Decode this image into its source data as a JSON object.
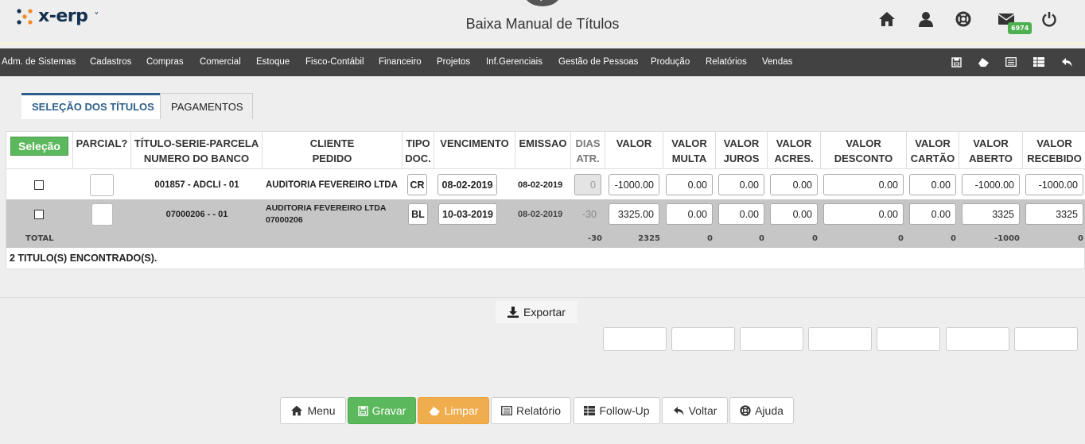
{
  "brand": {
    "name": "x-erp",
    "caret": "˅"
  },
  "page_title": "Baixa Manual de Títulos",
  "notifications": {
    "count": "6974"
  },
  "menu": [
    "Adm. de Sistemas",
    "Cadastros",
    "Compras",
    "Comercial",
    "Estoque",
    "Fisco-Contábil",
    "Financeiro",
    "Projetos",
    "Inf.Gerenciais",
    "Gestão de Pessoas",
    "Produção",
    "Relatórios",
    "Vendas"
  ],
  "tabs": {
    "selection": "SELEÇÃO DOS TÍTULOS",
    "payments": "PAGAMENTOS"
  },
  "table": {
    "select_button": "Seleção",
    "headers": {
      "parcial": "PARCIAL?",
      "titulo1": "TÍTULO-SERIE-PARCELA",
      "titulo2": "NUMERO DO BANCO",
      "cliente1": "CLIENTE",
      "cliente2": "PEDIDO",
      "tipo1": "TIPO",
      "tipo2": "DOC.",
      "vencimento": "VENCIMENTO",
      "emissao": "EMISSAO",
      "dias1": "DIAS",
      "dias2": "ATR.",
      "valor": "VALOR",
      "multa1": "VALOR",
      "multa2": "MULTA",
      "juros1": "VALOR",
      "juros2": "JUROS",
      "acres1": "VALOR",
      "acres2": "ACRES.",
      "desconto1": "VALOR",
      "desconto2": "DESCONTO",
      "cartao1": "VALOR",
      "cartao2": "CARTÃO",
      "aberto1": "VALOR",
      "aberto2": "ABERTO",
      "recebido1": "VALOR",
      "recebido2": "RECEBIDO"
    },
    "rows": [
      {
        "titulo": "001857 - ADCLI - 01",
        "cliente": "AUDITORIA FEVEREIRO LTDA",
        "pedido": "",
        "tipo": "CR",
        "vencimento": "08-02-2019",
        "emissao": "08-02-2019",
        "dias": "0",
        "valor": "-1000.00",
        "multa": "0.00",
        "juros": "0.00",
        "acres": "0.00",
        "desconto": "0.00",
        "cartao": "0.00",
        "aberto": "-1000.00",
        "recebido": "-1000.00"
      },
      {
        "titulo": "07000206 - - 01",
        "cliente": "AUDITORIA FEVEREIRO LTDA",
        "pedido": "07000206",
        "tipo": "BL",
        "vencimento": "10-03-2019",
        "emissao": "08-02-2019",
        "dias": "-30",
        "valor": "3325.00",
        "multa": "0.00",
        "juros": "0.00",
        "acres": "0.00",
        "desconto": "0.00",
        "cartao": "0.00",
        "aberto": "3325",
        "recebido": "3325"
      }
    ],
    "totals": {
      "label": "TOTAL",
      "dias": "-30",
      "valor": "2325",
      "multa": "0",
      "juros": "0",
      "acres": "0",
      "desconto": "0",
      "cartao": "0",
      "aberto": "-1000",
      "recebido": "0"
    },
    "found": "2 TITULO(S) ENCONTRADO(S)."
  },
  "export_label": "Exportar",
  "buttons": {
    "menu": "Menu",
    "gravar": "Gravar",
    "limpar": "Limpar",
    "relatorio": "Relatório",
    "followup": "Follow-Up",
    "voltar": "Voltar",
    "ajuda": "Ajuda"
  },
  "colors": {
    "menubar": "#424242",
    "accent": "#2d5f8a",
    "green": "#5cb85c",
    "orange": "#f0ad4e",
    "badge": "#4caf50"
  }
}
